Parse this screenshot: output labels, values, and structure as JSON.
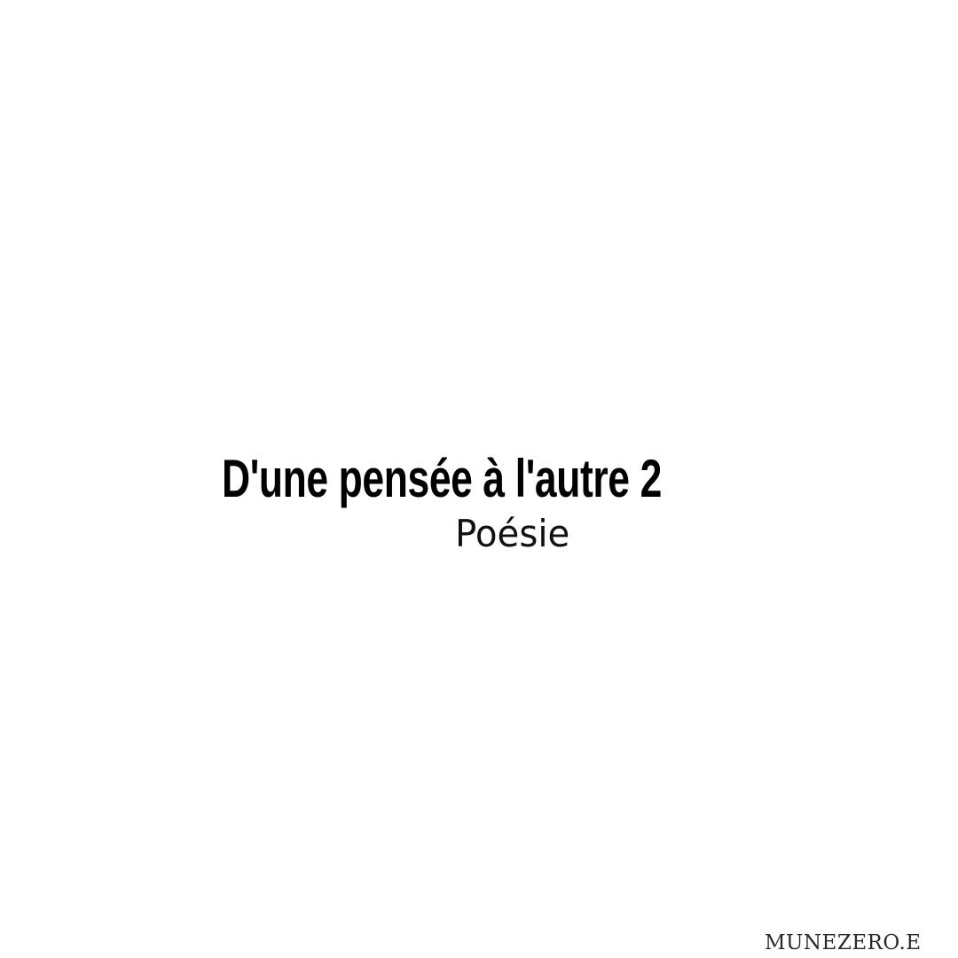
{
  "cover": {
    "title": "D'une pensée à l'autre 2",
    "subtitle": "Poésie",
    "signature": "MUNEZERO.E"
  },
  "colors": {
    "background": "#ffffff",
    "text": "#000000"
  }
}
